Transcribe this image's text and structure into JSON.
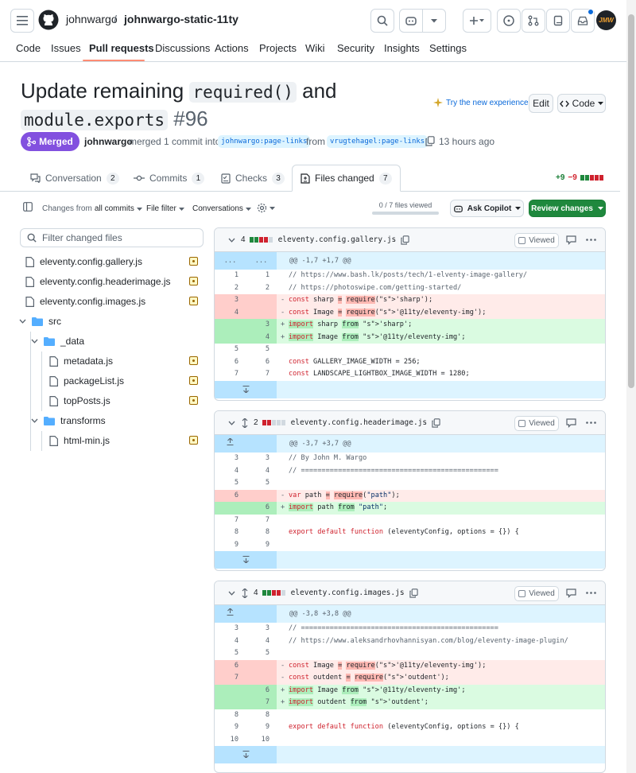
{
  "header": {
    "owner": "johnwargo",
    "separator": "/",
    "repo": "johnwargo-static-11ty",
    "avatar_text": "JMW"
  },
  "repo_nav": {
    "tabs": [
      "Code",
      "Issues",
      "Pull requests",
      "Discussions",
      "Actions",
      "Projects",
      "Wiki",
      "Security",
      "Insights",
      "Settings"
    ],
    "active": "Pull requests"
  },
  "pr": {
    "title_part1": "Update remaining ",
    "title_code1": "required()",
    "title_part2": " and",
    "title_code2": "module.exports",
    "number": "#96",
    "try_experience": "Try the new experience",
    "edit_label": "Edit",
    "code_label": "Code",
    "state_label": "Merged",
    "author": "johnwargo",
    "merged_text": "merged 1 commit into",
    "base_branch": "johnwargo:page-links",
    "from_text": "from",
    "head_branch": "vrugtehagel:page-links",
    "time_ago": "13 hours ago"
  },
  "tabs": {
    "conversation": {
      "label": "Conversation",
      "count": "2"
    },
    "commits": {
      "label": "Commits",
      "count": "1"
    },
    "checks": {
      "label": "Checks",
      "count": "3"
    },
    "files": {
      "label": "Files changed",
      "count": "7"
    },
    "additions": "+9",
    "deletions": "−9"
  },
  "toolbar": {
    "changes_from_prefix": "Changes from",
    "changes_from_value": "all commits",
    "file_filter": "File filter",
    "conversations": "Conversations",
    "files_viewed": "0 / 7 files viewed",
    "ask_copilot": "Ask Copilot",
    "review_changes": "Review changes"
  },
  "file_tree": {
    "filter_placeholder": "Filter changed files",
    "items": [
      {
        "label": "eleventy.config.gallery.js",
        "kind": "file"
      },
      {
        "label": "eleventy.config.headerimage.js",
        "kind": "file"
      },
      {
        "label": "eleventy.config.images.js",
        "kind": "file"
      },
      {
        "label": "src",
        "kind": "folder"
      },
      {
        "label": "_data",
        "kind": "folder"
      },
      {
        "label": "metadata.js",
        "kind": "file"
      },
      {
        "label": "packageList.js",
        "kind": "file"
      },
      {
        "label": "topPosts.js",
        "kind": "file"
      },
      {
        "label": "transforms",
        "kind": "folder"
      },
      {
        "label": "html-min.js",
        "kind": "file"
      }
    ]
  },
  "diffs": [
    {
      "count": "4",
      "filename": "eleventy.config.gallery.js",
      "viewed_label": "Viewed",
      "hunk_left": "...",
      "hunk_right": "...",
      "hunk": "@@ -1,7 +1,7 @@",
      "lines": [
        {
          "type": "ctx",
          "old": "1",
          "new": "1",
          "sign": " ",
          "text": "// https://www.bash.lk/posts/tech/1-elventy-image-gallery/"
        },
        {
          "type": "ctx",
          "old": "2",
          "new": "2",
          "sign": " ",
          "text": "// https://photoswipe.com/getting-started/"
        },
        {
          "type": "del",
          "old": "3",
          "new": "",
          "sign": "-",
          "text": "const sharp = require('sharp');"
        },
        {
          "type": "del",
          "old": "4",
          "new": "",
          "sign": "-",
          "text": "const Image = require('@11ty/eleventy-img');"
        },
        {
          "type": "add",
          "old": "",
          "new": "3",
          "sign": "+",
          "text": "import sharp from 'sharp';"
        },
        {
          "type": "add",
          "old": "",
          "new": "4",
          "sign": "+",
          "text": "import Image from '@11ty/eleventy-img';"
        },
        {
          "type": "ctx",
          "old": "5",
          "new": "5",
          "sign": " ",
          "text": ""
        },
        {
          "type": "ctx",
          "old": "6",
          "new": "6",
          "sign": " ",
          "text": "const GALLERY_IMAGE_WIDTH = 256;"
        },
        {
          "type": "ctx",
          "old": "7",
          "new": "7",
          "sign": " ",
          "text": "const LANDSCAPE_LIGHTBOX_IMAGE_WIDTH = 1280;"
        }
      ]
    },
    {
      "count": "2",
      "filename": "eleventy.config.headerimage.js",
      "viewed_label": "Viewed",
      "hunk": "@@ -3,7 +3,7 @@",
      "lines": [
        {
          "type": "ctx",
          "old": "3",
          "new": "3",
          "sign": " ",
          "text": "// By John M. Wargo"
        },
        {
          "type": "ctx",
          "old": "4",
          "new": "4",
          "sign": " ",
          "text": "// ================================================"
        },
        {
          "type": "ctx",
          "old": "5",
          "new": "5",
          "sign": " ",
          "text": ""
        },
        {
          "type": "del",
          "old": "6",
          "new": "",
          "sign": "-",
          "text": "var path = require(\"path\");"
        },
        {
          "type": "add",
          "old": "",
          "new": "6",
          "sign": "+",
          "text": "import path from \"path\";"
        },
        {
          "type": "ctx",
          "old": "7",
          "new": "7",
          "sign": " ",
          "text": ""
        },
        {
          "type": "ctx",
          "old": "8",
          "new": "8",
          "sign": " ",
          "text": "export default function (eleventyConfig, options = {}) {"
        },
        {
          "type": "ctx",
          "old": "9",
          "new": "9",
          "sign": " ",
          "text": ""
        }
      ]
    },
    {
      "count": "4",
      "filename": "eleventy.config.images.js",
      "viewed_label": "Viewed",
      "hunk": "@@ -3,8 +3,8 @@",
      "lines": [
        {
          "type": "ctx",
          "old": "3",
          "new": "3",
          "sign": " ",
          "text": "// ================================================"
        },
        {
          "type": "ctx",
          "old": "4",
          "new": "4",
          "sign": " ",
          "text": "// https://www.aleksandrhovhannisyan.com/blog/eleventy-image-plugin/"
        },
        {
          "type": "ctx",
          "old": "5",
          "new": "5",
          "sign": " ",
          "text": ""
        },
        {
          "type": "del",
          "old": "6",
          "new": "",
          "sign": "-",
          "text": "const Image = require('@11ty/eleventy-img');"
        },
        {
          "type": "del",
          "old": "7",
          "new": "",
          "sign": "-",
          "text": "const outdent = require('outdent');"
        },
        {
          "type": "add",
          "old": "",
          "new": "6",
          "sign": "+",
          "text": "import Image from '@11ty/eleventy-img';"
        },
        {
          "type": "add",
          "old": "",
          "new": "7",
          "sign": "+",
          "text": "import outdent from 'outdent';"
        },
        {
          "type": "ctx",
          "old": "8",
          "new": "8",
          "sign": " ",
          "text": ""
        },
        {
          "type": "ctx",
          "old": "9",
          "new": "9",
          "sign": " ",
          "text": "export default function (eleventyConfig, options = {}) {"
        },
        {
          "type": "ctx",
          "old": "10",
          "new": "10",
          "sign": " ",
          "text": ""
        }
      ]
    }
  ],
  "colors": {
    "accent": "#0969da",
    "merged": "#8250df",
    "primary_button": "#1f883d",
    "tab_underline": "#fd8c73",
    "addition": "#1a7f37",
    "deletion": "#d1242f"
  }
}
